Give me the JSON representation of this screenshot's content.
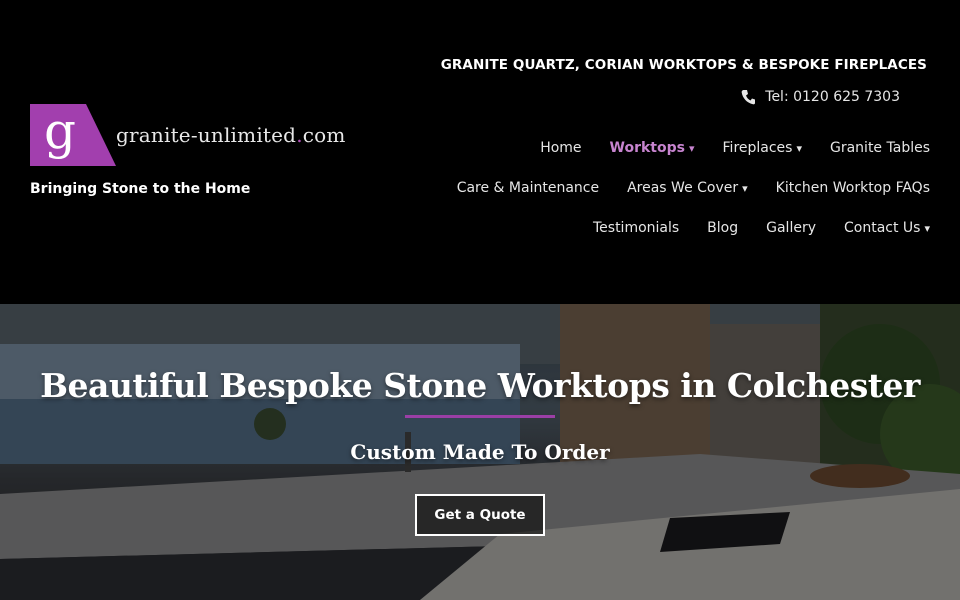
{
  "brand": {
    "logo_letter": "g",
    "logo_name": "granite-unlimited",
    "logo_dot": ".",
    "logo_tld": "com",
    "tagline": "Bringing Stone to the Home",
    "accent_color": "#9b3fa6"
  },
  "header": {
    "title": "GRANITE QUARTZ, CORIAN WORKTOPS & BESPOKE FIREPLACES",
    "phone": "Tel: 0120 625 7303",
    "phone_icon": "phone-icon"
  },
  "nav": {
    "row1": [
      {
        "label": "Home",
        "caret": ""
      },
      {
        "label": "Worktops",
        "caret": "▾"
      },
      {
        "label": "Fireplaces",
        "caret": "▾"
      },
      {
        "label": "Granite Tables",
        "caret": ""
      }
    ],
    "row2": [
      {
        "label": "Care & Maintenance",
        "caret": ""
      },
      {
        "label": "Areas We Cover",
        "caret": "▾"
      },
      {
        "label": "Kitchen Worktop FAQs",
        "caret": ""
      }
    ],
    "row3": [
      {
        "label": "Testimonials",
        "caret": ""
      },
      {
        "label": "Blog",
        "caret": ""
      },
      {
        "label": "Gallery",
        "caret": ""
      },
      {
        "label": "Contact Us",
        "caret": "▾"
      }
    ],
    "active": "Worktops"
  },
  "hero": {
    "title": "Beautiful Bespoke Stone Worktops in Colchester",
    "subtitle": "Custom Made To Order",
    "cta_label": "Get a Quote"
  }
}
